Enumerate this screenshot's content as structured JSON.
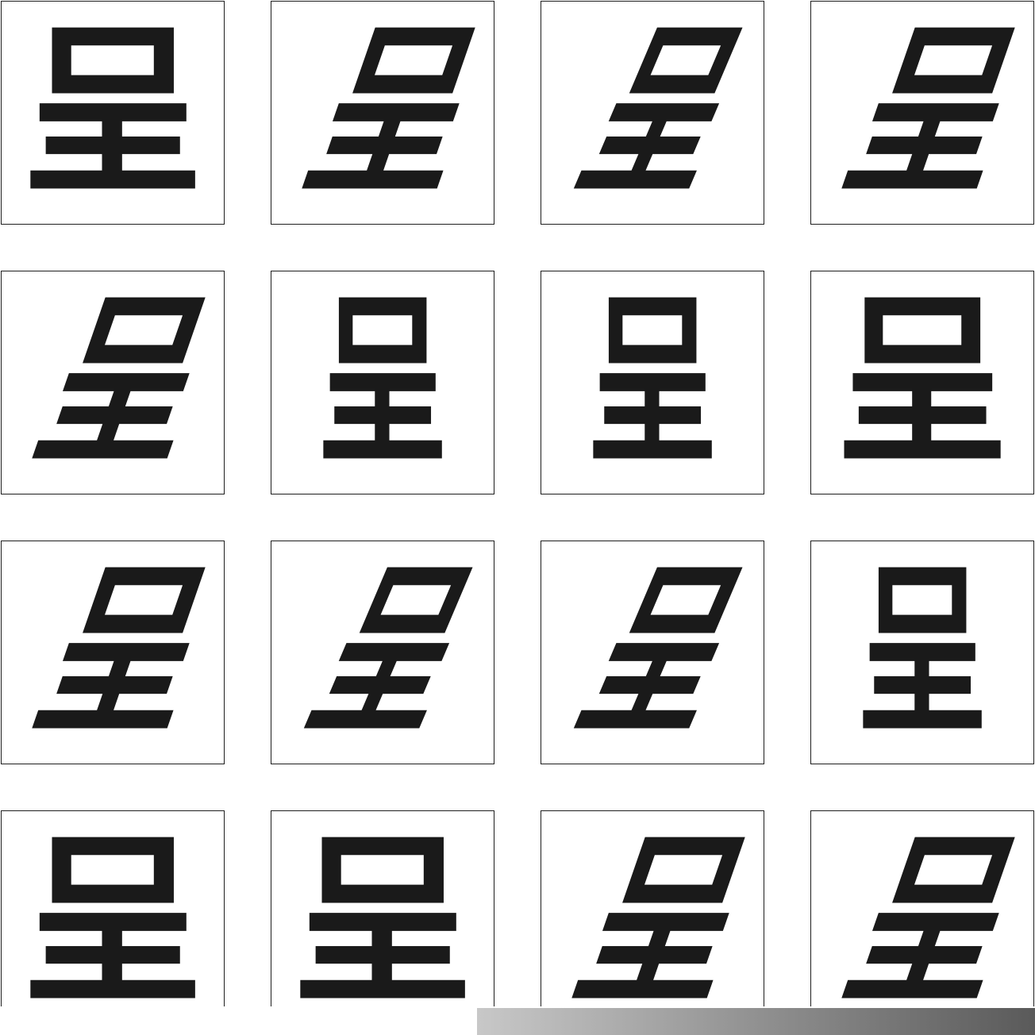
{
  "cells": [
    {
      "glyph": "呈",
      "style": "regular"
    },
    {
      "glyph": "呈",
      "style": "cursive"
    },
    {
      "glyph": "呈",
      "style": "cursive2"
    },
    {
      "glyph": "呈",
      "style": "cursive"
    },
    {
      "glyph": "呈",
      "style": "cursive"
    },
    {
      "glyph": "呈",
      "style": "narrow"
    },
    {
      "glyph": "呈",
      "style": "narrow"
    },
    {
      "glyph": "呈",
      "style": "wide"
    },
    {
      "glyph": "呈",
      "style": "cursive"
    },
    {
      "glyph": "呈",
      "style": "cursive2"
    },
    {
      "glyph": "呈",
      "style": "cursive2"
    },
    {
      "glyph": "呈",
      "style": "narrow"
    },
    {
      "glyph": "呈",
      "style": "regular"
    },
    {
      "glyph": "呈",
      "style": "regular"
    },
    {
      "glyph": "呈",
      "style": "cursive"
    },
    {
      "glyph": "呈",
      "style": "cursive"
    }
  ],
  "colors": {
    "ink": "#1a1a1a",
    "border": "#1e1e1e",
    "gradient_start": "#c8c8c8",
    "gradient_end": "#5a5a5a"
  }
}
